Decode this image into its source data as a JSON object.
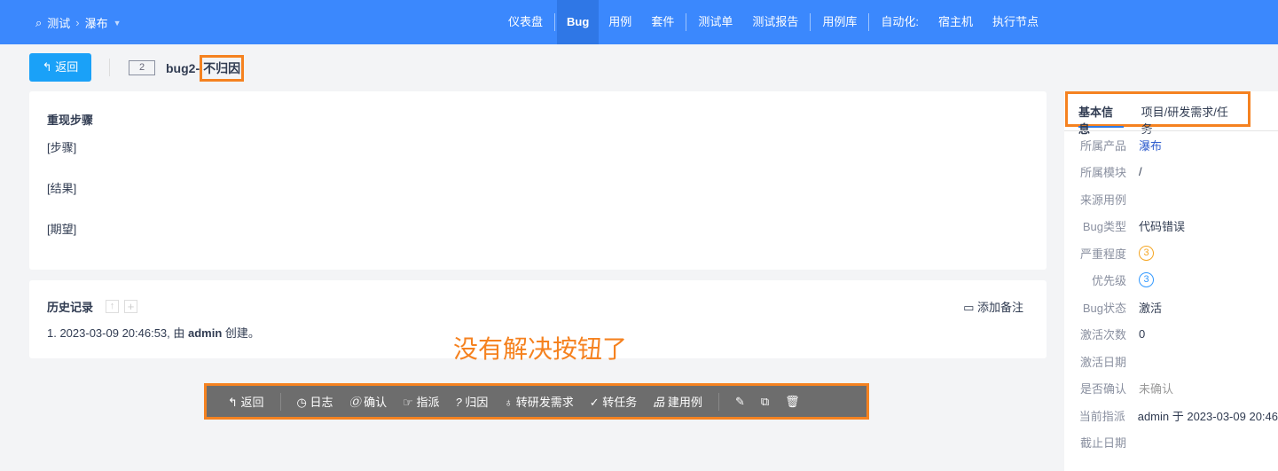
{
  "header": {
    "search_icon": "search-icon",
    "app": "测试",
    "product": "瀑布",
    "nav": [
      "仪表盘",
      "Bug",
      "用例",
      "套件",
      "测试单",
      "测试报告",
      "用例库",
      "自动化:",
      "宿主机",
      "执行节点"
    ]
  },
  "titlebar": {
    "back": "返回",
    "id": "2",
    "title_prefix": "bug2-",
    "title_highlight": "不归因"
  },
  "steps": {
    "heading": "重现步骤",
    "lines": [
      "[步骤]",
      "[结果]",
      "[期望]"
    ]
  },
  "history": {
    "heading": "历史记录",
    "add_note": "添加备注",
    "entry_prefix": "1. 2023-03-09 20:46:53, 由 ",
    "entry_user": "admin",
    "entry_suffix": " 创建。"
  },
  "annotation": "没有解决按钮了",
  "toolbar": {
    "items": [
      "返回",
      "日志",
      "确认",
      "指派",
      "归因",
      "转研发需求",
      "转任务",
      "建用例"
    ]
  },
  "sidebar": {
    "tabs": [
      "基本信息",
      "项目/研发需求/任务"
    ],
    "rows": [
      [
        "所属产品",
        "瀑布"
      ],
      [
        "所属模块",
        "/"
      ],
      [
        "来源用例",
        ""
      ],
      [
        "Bug类型",
        "代码错误"
      ],
      [
        "严重程度",
        "3"
      ],
      [
        "优先级",
        "3"
      ],
      [
        "Bug状态",
        "激活"
      ],
      [
        "激活次数",
        "0"
      ],
      [
        "激活日期",
        ""
      ],
      [
        "是否确认",
        "未确认"
      ],
      [
        "当前指派",
        "admin 于 2023-03-09 20:46"
      ],
      [
        "截止日期",
        ""
      ]
    ]
  },
  "colors": {
    "primary": "#3b88fd",
    "highlight": "#f58220"
  }
}
